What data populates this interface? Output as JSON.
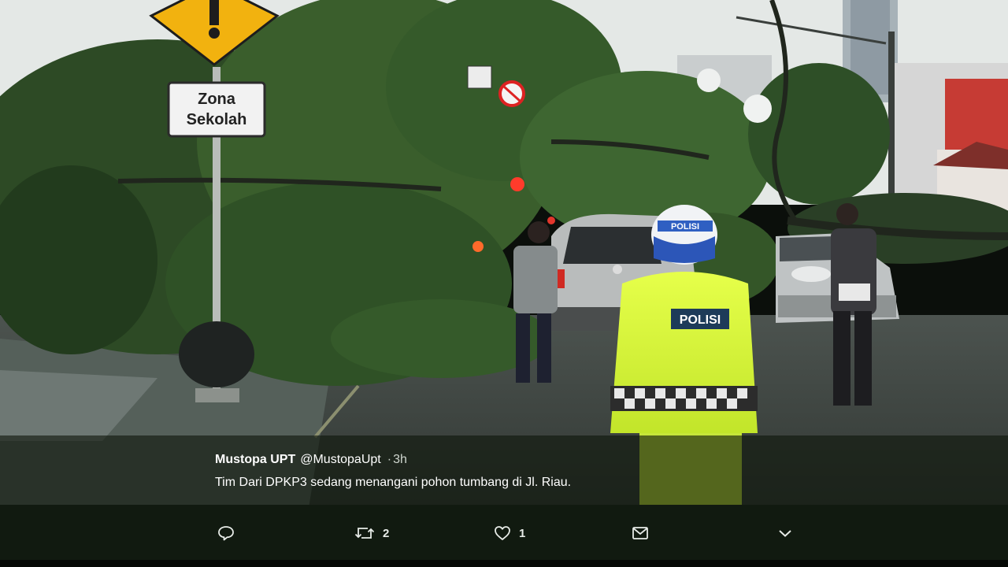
{
  "scene": {
    "sign_text": [
      "Zona",
      "Sekolah"
    ],
    "helmet_text": "POLISI",
    "vest_text": "POLISI"
  },
  "tweet": {
    "name": "Mustopa UPT",
    "handle": "@MustopaUpt",
    "separator": "·",
    "time": "3h",
    "text": "Tim Dari DPKP3 sedang menangani pohon tumbang di Jl. Riau."
  },
  "actions": {
    "reply_icon": "reply-icon",
    "retweet_icon": "retweet-icon",
    "retweet_count": "2",
    "like_icon": "heart-icon",
    "like_count": "1",
    "dm_icon": "envelope-icon",
    "more_icon": "chevron-down-icon"
  }
}
